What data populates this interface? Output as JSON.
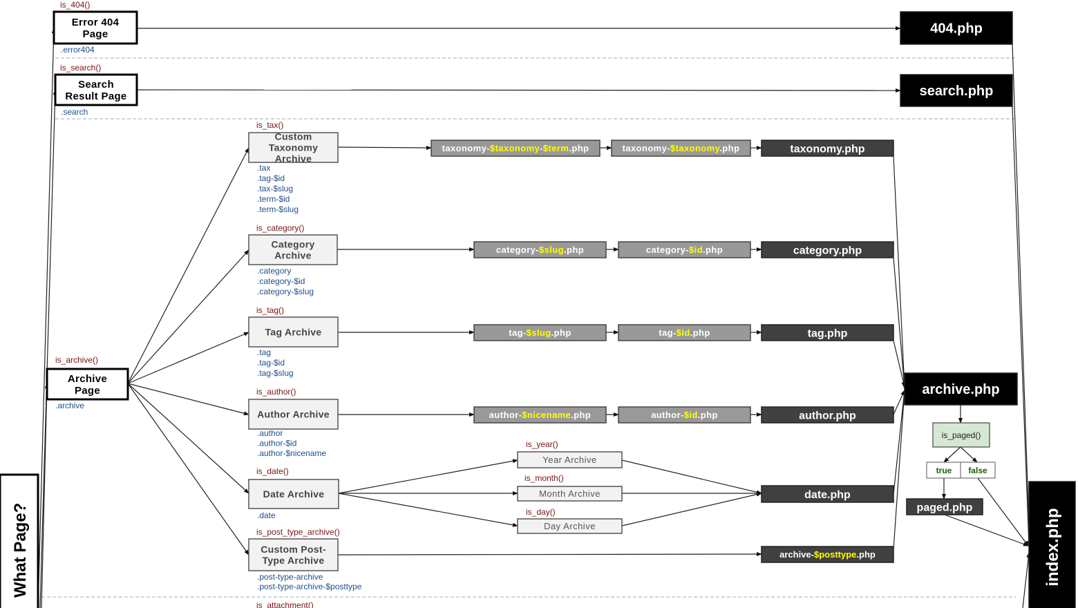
{
  "title": "What Page?",
  "page_types": [
    {
      "id": "error404",
      "label": [
        "Error 404",
        "Page"
      ],
      "condition": "is_404()",
      "classes": [
        ".error404"
      ]
    },
    {
      "id": "search",
      "label": [
        "Search",
        "Result Page"
      ],
      "condition": "is_search()",
      "classes": [
        ".search"
      ]
    },
    {
      "id": "archive",
      "label": [
        "Archive",
        "Page"
      ],
      "condition": "is_archive()",
      "classes": [
        ".archive"
      ]
    },
    {
      "id": "tax",
      "label": [
        "Custom",
        "Taxonomy",
        "Archive"
      ],
      "condition": "is_tax()",
      "classes": [
        ".tax",
        ".tag-$id",
        ".tax-$slug",
        ".term-$id",
        ".term-$slug"
      ]
    },
    {
      "id": "category",
      "label": [
        "Category",
        "Archive"
      ],
      "condition": "is_category()",
      "classes": [
        ".category",
        ".category-$id",
        ".category-$slug"
      ]
    },
    {
      "id": "tag",
      "label": [
        "Tag Archive"
      ],
      "condition": "is_tag()",
      "classes": [
        ".tag",
        ".tag-$id",
        ".tag-$slug"
      ]
    },
    {
      "id": "author",
      "label": [
        "Author Archive"
      ],
      "condition": "is_author()",
      "classes": [
        ".author",
        ".author-$id",
        ".author-$nicename"
      ]
    },
    {
      "id": "date",
      "label": [
        "Date Archive"
      ],
      "condition": "is_date()",
      "classes": [
        ".date"
      ]
    },
    {
      "id": "cpt",
      "label": [
        "Custom Post-",
        "Type Archive"
      ],
      "condition": "is_post_type_archive()",
      "classes": [
        ".post-type-archive",
        ".post-type-archive-$posttype"
      ]
    },
    {
      "id": "year",
      "label": [
        "Year Archive"
      ],
      "condition": "is_year()",
      "classes": []
    },
    {
      "id": "month",
      "label": [
        "Month Archive"
      ],
      "condition": "is_month()",
      "classes": []
    },
    {
      "id": "day",
      "label": [
        "Day Archive"
      ],
      "condition": "is_day()",
      "classes": []
    },
    {
      "id": "attachment",
      "label": [],
      "condition": "is_attachment()",
      "classes": []
    }
  ],
  "templates": [
    {
      "id": "t404",
      "parts": [
        {
          "text": "404.php",
          "var": false
        }
      ]
    },
    {
      "id": "tsearch",
      "parts": [
        {
          "text": "search.php",
          "var": false
        }
      ]
    },
    {
      "id": "tax1",
      "parts": [
        {
          "text": "taxonomy-",
          "var": false
        },
        {
          "text": "$taxonomy",
          "var": true
        },
        {
          "text": "-",
          "var": false
        },
        {
          "text": "$term",
          "var": true
        },
        {
          "text": ".php",
          "var": false
        }
      ]
    },
    {
      "id": "tax2",
      "parts": [
        {
          "text": "taxonomy-",
          "var": false
        },
        {
          "text": "$taxonomy",
          "var": true
        },
        {
          "text": ".php",
          "var": false
        }
      ]
    },
    {
      "id": "taxphp",
      "parts": [
        {
          "text": "taxonomy.php",
          "var": false
        }
      ]
    },
    {
      "id": "cat1",
      "parts": [
        {
          "text": "category-",
          "var": false
        },
        {
          "text": "$slug",
          "var": true
        },
        {
          "text": ".php",
          "var": false
        }
      ]
    },
    {
      "id": "cat2",
      "parts": [
        {
          "text": "category-",
          "var": false
        },
        {
          "text": "$id",
          "var": true
        },
        {
          "text": ".php",
          "var": false
        }
      ]
    },
    {
      "id": "catphp",
      "parts": [
        {
          "text": "category.php",
          "var": false
        }
      ]
    },
    {
      "id": "tag1",
      "parts": [
        {
          "text": "tag-",
          "var": false
        },
        {
          "text": "$slug",
          "var": true
        },
        {
          "text": ".php",
          "var": false
        }
      ]
    },
    {
      "id": "tag2",
      "parts": [
        {
          "text": "tag-",
          "var": false
        },
        {
          "text": "$id",
          "var": true
        },
        {
          "text": ".php",
          "var": false
        }
      ]
    },
    {
      "id": "tagphp",
      "parts": [
        {
          "text": "tag.php",
          "var": false
        }
      ]
    },
    {
      "id": "author1",
      "parts": [
        {
          "text": "author-",
          "var": false
        },
        {
          "text": "$nicename",
          "var": true
        },
        {
          "text": ".php",
          "var": false
        }
      ]
    },
    {
      "id": "author2",
      "parts": [
        {
          "text": "author-",
          "var": false
        },
        {
          "text": "$id",
          "var": true
        },
        {
          "text": ".php",
          "var": false
        }
      ]
    },
    {
      "id": "authorphp",
      "parts": [
        {
          "text": "author.php",
          "var": false
        }
      ]
    },
    {
      "id": "datephp",
      "parts": [
        {
          "text": "date.php",
          "var": false
        }
      ]
    },
    {
      "id": "archposttype",
      "parts": [
        {
          "text": "archive-",
          "var": false
        },
        {
          "text": "$posttype",
          "var": true
        },
        {
          "text": ".php",
          "var": false
        }
      ]
    },
    {
      "id": "archivephp",
      "parts": [
        {
          "text": "archive.php",
          "var": false
        }
      ]
    },
    {
      "id": "pagedphp",
      "parts": [
        {
          "text": "paged.php",
          "var": false
        }
      ]
    },
    {
      "id": "indexphp",
      "parts": [
        {
          "text": "index.php",
          "var": false
        }
      ]
    }
  ],
  "paged_check": {
    "condition": "is_paged()",
    "true_label": "true",
    "false_label": "false"
  },
  "colors": {
    "condition_text": "#7a1010",
    "class_text": "#1f4e8c",
    "variable_highlight": "#ffff00",
    "specific_template": "#999999",
    "generic_template": "#404040",
    "final_template": "#000000",
    "decision_fill": "#d5e8d4",
    "branch_text": "#1e5c00"
  }
}
